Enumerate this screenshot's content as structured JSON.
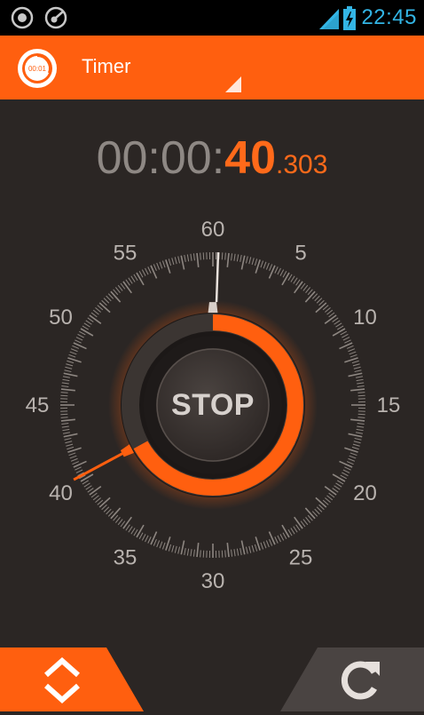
{
  "status_bar": {
    "time": "22:45",
    "icons": [
      "notification-target-icon",
      "notification-dial-icon",
      "wifi-icon",
      "signal-icon",
      "battery-charging-icon"
    ],
    "accent_color": "#33b5e5"
  },
  "app_bar": {
    "logo_text": "00:01",
    "title": "Timer",
    "color": "#ff5f0f"
  },
  "timer": {
    "hours": "00",
    "sep1": ":",
    "minutes": "00",
    "sep2": ":",
    "seconds": "40",
    "millis": ".303",
    "accent_color": "#ff6a1a"
  },
  "dial": {
    "numbers": [
      "60",
      "5",
      "10",
      "15",
      "20",
      "25",
      "30",
      "35",
      "40",
      "45",
      "50",
      "55"
    ],
    "seconds_value": 40.303,
    "progress_fraction": 0.67
  },
  "controls": {
    "stop_label": "STOP",
    "expand_icon": "expand-collapse-chevrons-icon",
    "reset_icon": "reset-refresh-icon"
  }
}
